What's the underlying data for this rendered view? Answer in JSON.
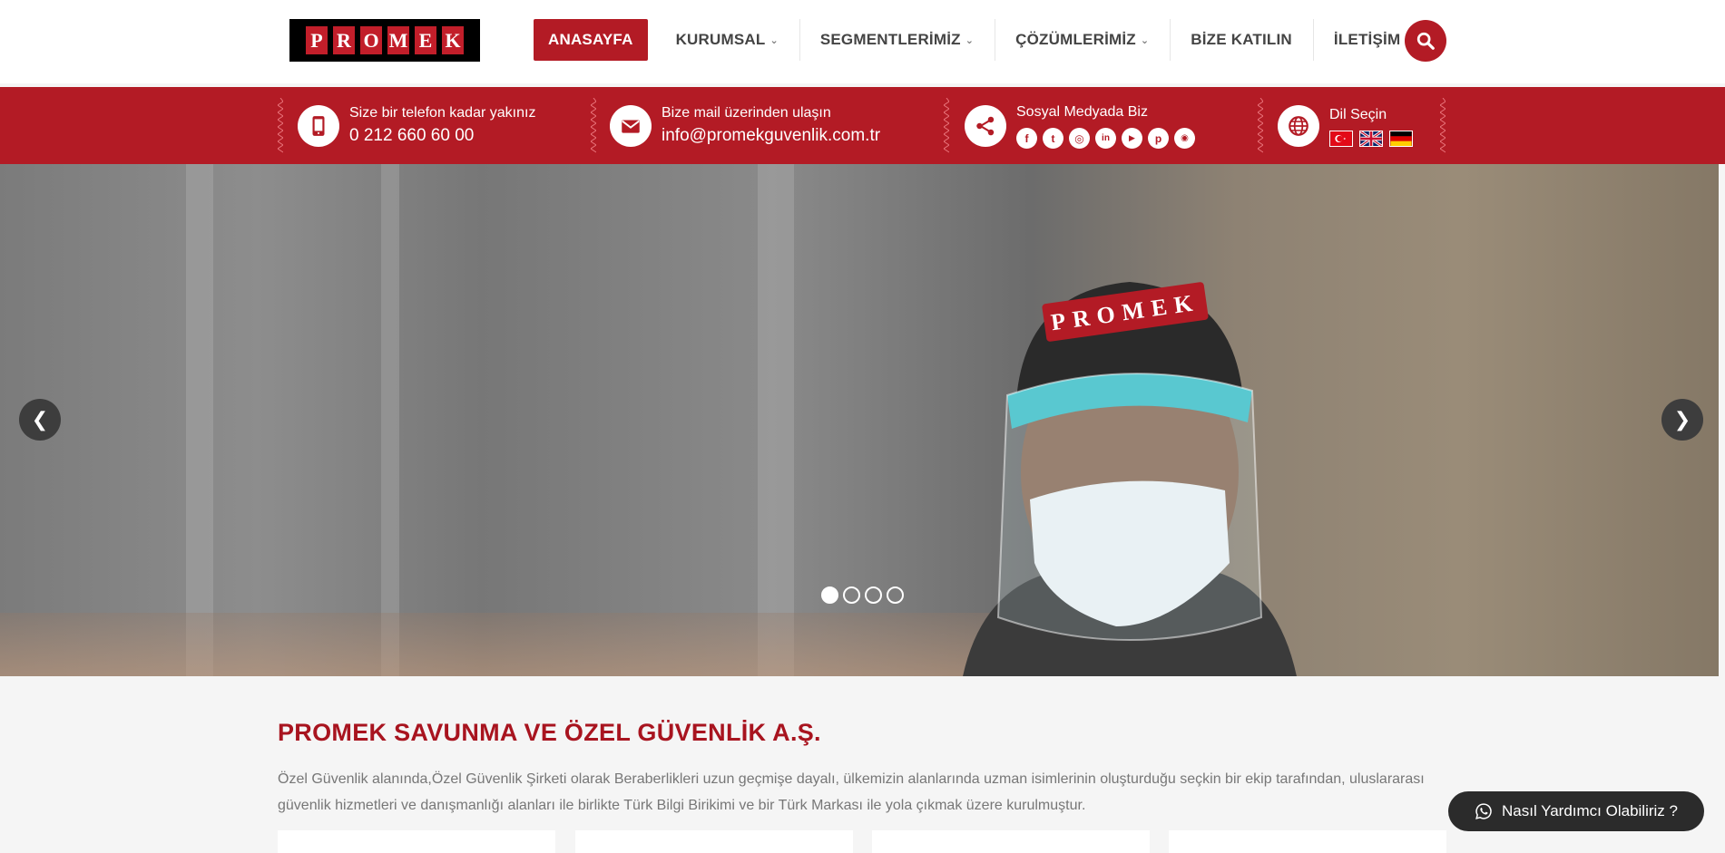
{
  "logo": {
    "letters": [
      "P",
      "R",
      "O",
      "M",
      "E",
      "K"
    ]
  },
  "nav": {
    "items": [
      {
        "label": "ANASAYFA",
        "active": true,
        "dropdown": false
      },
      {
        "label": "KURUMSAL",
        "active": false,
        "dropdown": true
      },
      {
        "label": "SEGMENTLERİMİZ",
        "active": false,
        "dropdown": true
      },
      {
        "label": "ÇÖZÜMLERİMİZ",
        "active": false,
        "dropdown": true
      },
      {
        "label": "BİZE KATILIN",
        "active": false,
        "dropdown": false
      },
      {
        "label": "İLETİŞİM",
        "active": false,
        "dropdown": false
      }
    ],
    "caret": "⌄",
    "search_icon": "search-icon"
  },
  "info_bar": {
    "phone": {
      "title": "Size bir telefon kadar yakınız",
      "value": "0 212 660 60 00",
      "icon": "mobile-phone-icon"
    },
    "mail": {
      "title": "Bize mail üzerinden ulaşın",
      "value": "info@promekguvenlik.com.tr",
      "icon": "envelope-icon"
    },
    "social": {
      "title": "Sosyal Medyada Biz",
      "icon": "share-icon",
      "links": [
        {
          "name": "facebook-icon",
          "glyph": "f"
        },
        {
          "name": "twitter-icon",
          "glyph": "t"
        },
        {
          "name": "instagram-icon",
          "glyph": "◎"
        },
        {
          "name": "linkedin-icon",
          "glyph": "in"
        },
        {
          "name": "youtube-icon",
          "glyph": "▶"
        },
        {
          "name": "pinterest-icon",
          "glyph": "p"
        },
        {
          "name": "rss-icon",
          "glyph": "◉"
        }
      ]
    },
    "language": {
      "title": "Dil Seçin",
      "icon": "globe-icon",
      "flags": [
        "turkey-flag-icon",
        "uk-flag-icon",
        "germany-flag-icon"
      ]
    }
  },
  "slider": {
    "prev_icon": "chevron-left-icon",
    "next_icon": "chevron-right-icon",
    "prev_glyph": "❮",
    "next_glyph": "❯",
    "slide_count": 4,
    "active_slide": 0
  },
  "about": {
    "title": "PROMEK SAVUNMA VE ÖZEL GÜVENLİK A.Ş.",
    "text": "Özel Güvenlik alanında,Özel Güvenlik Şirketi olarak Beraberlikleri uzun geçmişe dayalı, ülkemizin alanlarında uzman isimlerinin oluşturduğu seçkin bir ekip tarafından, uluslararası güvenlik hizmetleri ve danışmanlığı alanları ile birlikte Türk Bilgi Birikimi ve bir Türk Markası ile yola çıkmak üzere kurulmuştur."
  },
  "whatsapp": {
    "label": "Nasıl Yardımcı Olabiliriz ?",
    "icon": "whatsapp-icon"
  },
  "colors": {
    "brand_red": "#b31b25",
    "title_red": "#a8141f",
    "dark": "#2b2b2b"
  }
}
